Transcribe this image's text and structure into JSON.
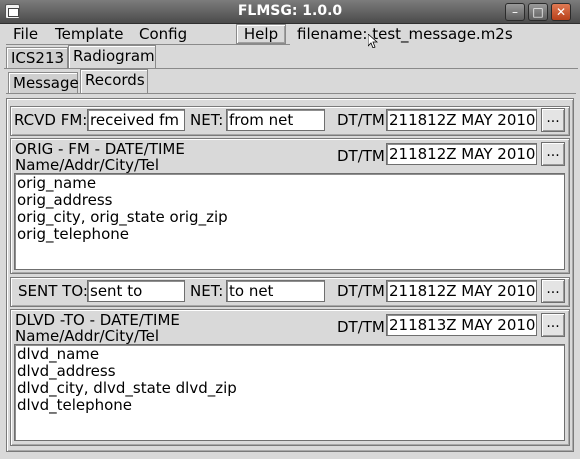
{
  "window": {
    "title": "FLMSG: 1.0.0"
  },
  "menu": {
    "file_label": "File",
    "template_label": "Template",
    "config_label": "Config",
    "help_label": "Help",
    "filename_text": "filename: test_message.m2s"
  },
  "tabs_top": [
    {
      "label": "ICS213"
    },
    {
      "label": "Radiogram"
    }
  ],
  "tabs_sub": [
    {
      "label": "Message"
    },
    {
      "label": "Records"
    }
  ],
  "rcvd": {
    "rcvd_fm_label": "RCVD FM:",
    "rcvd_fm_value": "received fm",
    "net_label": "NET:",
    "net_value": "from net",
    "dttm_label": "DT/TM",
    "dttm_value": "211812Z MAY 2010",
    "button_label": "..."
  },
  "orig": {
    "header_line1": "ORIG - FM - DATE/TIME",
    "header_line2": "Name/Addr/City/Tel",
    "dttm_label": "DT/TM",
    "dttm_value": "211812Z MAY 2010",
    "button_label": "...",
    "lines": [
      "orig_name",
      "orig_address",
      "orig_city, orig_state orig_zip",
      "orig_telephone"
    ]
  },
  "sent": {
    "sent_to_label": "SENT TO:",
    "sent_to_value": "sent to",
    "net_label": "NET:",
    "net_value": "to net",
    "dttm_label": "DT/TM",
    "dttm_value": "211812Z MAY 2010",
    "button_label": "..."
  },
  "dlvd": {
    "header_line1": "DLVD -TO - DATE/TIME",
    "header_line2": "Name/Addr/City/Tel",
    "dttm_label": "DT/TM",
    "dttm_value": "211813Z MAY 2010",
    "button_label": "...",
    "lines": [
      "dlvd_name",
      "dlvd_address",
      "dlvd_city, dlvd_state dlvd_zip",
      "dlvd_telephone"
    ]
  },
  "icons": {
    "system": "window-menu-icon",
    "minimize": "minimize-icon",
    "maximize": "maximize-icon",
    "close": "close-icon",
    "cursor": "mouse-pointer-icon"
  }
}
